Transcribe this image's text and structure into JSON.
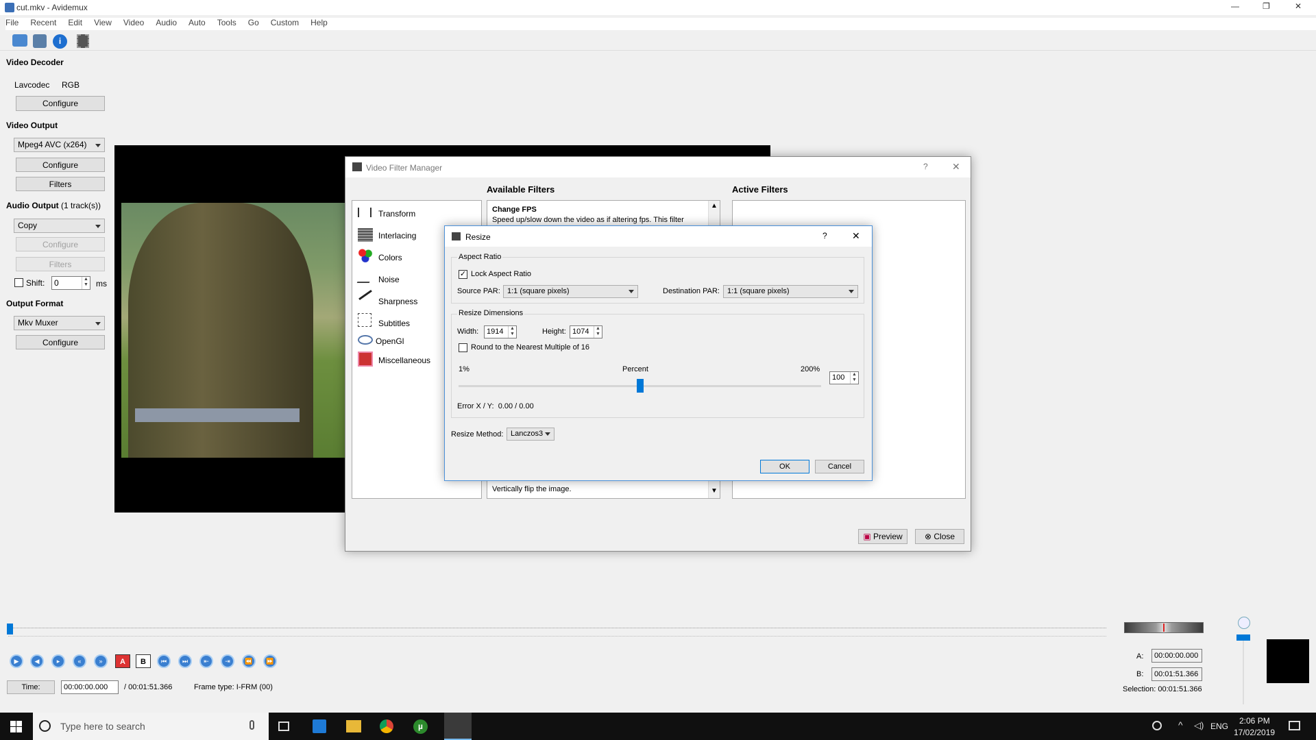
{
  "window": {
    "title": "cut.mkv - Avidemux",
    "min": "—",
    "max": "❐",
    "close": "✕"
  },
  "menu": [
    "File",
    "Recent",
    "Edit",
    "View",
    "Video",
    "Audio",
    "Auto",
    "Tools",
    "Go",
    "Custom",
    "Help"
  ],
  "left": {
    "video_decoder": {
      "title": "Video Decoder",
      "codec": "Lavcodec",
      "format": "RGB",
      "configure": "Configure"
    },
    "video_output": {
      "title": "Video Output",
      "codec": "Mpeg4 AVC (x264)",
      "configure": "Configure",
      "filters": "Filters"
    },
    "audio_output": {
      "title": "Audio Output",
      "tracks": "(1 track(s))",
      "codec": "Copy",
      "configure": "Configure",
      "filters": "Filters",
      "shift_label": "Shift:",
      "shift_value": "0",
      "ms": "ms"
    },
    "output_format": {
      "title": "Output Format",
      "muxer": "Mkv Muxer",
      "configure": "Configure"
    }
  },
  "vfm": {
    "title": "Video Filter Manager",
    "help": "?",
    "close_x": "✕",
    "categories": [
      "Transform",
      "Interlacing",
      "Colors",
      "Noise",
      "Sharpness",
      "Subtitles",
      "OpenGl",
      "Miscellaneous"
    ],
    "available_title": "Available Filters",
    "active_title": "Active Filters",
    "first_filter_name": "Change FPS",
    "first_filter_desc": "Speed up/slow down the video as if altering fps. This filter",
    "last_filter_desc": "Vertically flip the image.",
    "preview": "Preview",
    "close": "Close"
  },
  "resize": {
    "title": "Resize",
    "help": "?",
    "close_x": "✕",
    "aspect_group": "Aspect Ratio",
    "lock_label": "Lock Aspect Ratio",
    "lock_checked": "✓",
    "source_par_label": "Source PAR:",
    "source_par": "1:1 (square pixels)",
    "dest_par_label": "Destination PAR:",
    "dest_par": "1:1 (square pixels)",
    "dims_group": "Resize Dimensions",
    "width_label": "Width:",
    "width": "1914",
    "height_label": "Height:",
    "height": "1074",
    "round_label": "Round to the Nearest Multiple of 16",
    "min_pct": "1%",
    "percent_label": "Percent",
    "max_pct": "200%",
    "percent_value": "100",
    "slider_fraction": 0.5,
    "error_label": "Error X / Y:",
    "error_value": "0.00 / 0.00",
    "method_label": "Resize Method:",
    "method": "Lanczos3",
    "ok": "OK",
    "cancel": "Cancel"
  },
  "bottom": {
    "time_label": "Time:",
    "time": "00:00:00.000",
    "duration": "/ 00:01:51.366",
    "frame_type": "Frame type:  I-FRM (00)",
    "a_label": "A:",
    "a_value": "00:00:00.000",
    "b_label": "B:",
    "b_value": "00:01:51.366",
    "selection": "Selection: 00:01:51.366"
  },
  "taskbar": {
    "search_placeholder": "Type here to search",
    "lang": "ENG",
    "time": "2:06 PM",
    "date": "17/02/2019"
  },
  "colors": {
    "accent": "#0078d7",
    "taskbar": "#101010",
    "dialog_border": "#4a90d9"
  }
}
